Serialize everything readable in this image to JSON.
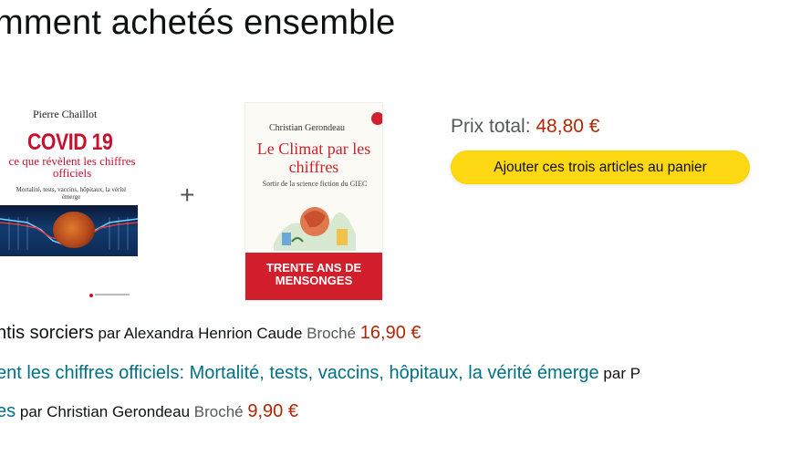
{
  "heading": "mment achetés ensemble",
  "book1": {
    "author": "Pierre Chaillot",
    "title": "COVID 19",
    "subtitle": "ce que révèlent les chiffres officiels",
    "tagline": "Mortalité, tests, vaccins, hôpitaux, la vérité émerge"
  },
  "plus_sign": "+",
  "book2": {
    "author": "Christian Gerondeau",
    "title": "Le Climat par les chiffres",
    "subtitle": "Sortir de la science fiction du GIEC",
    "banner": "TRENTE ANS DE MENSONGES"
  },
  "total": {
    "label": "Prix total:",
    "price": "48,80 €"
  },
  "cart_button": "Ajouter ces trois articles au panier",
  "items": [
    {
      "title": "ntis sorciers",
      "by": "par Alexandra Henrion Caude",
      "format": "Broché",
      "price": "16,90 €"
    },
    {
      "title": "ent les chiffres officiels: Mortalité, tests, vaccins, hôpitaux, la vérité émerge",
      "by": "par P"
    },
    {
      "title": "es",
      "by": "par Christian Gerondeau",
      "format": "Broché",
      "price": "9,90 €"
    }
  ],
  "colors": {
    "price": "#b12704",
    "link": "#007185",
    "button": "#ffd814"
  }
}
